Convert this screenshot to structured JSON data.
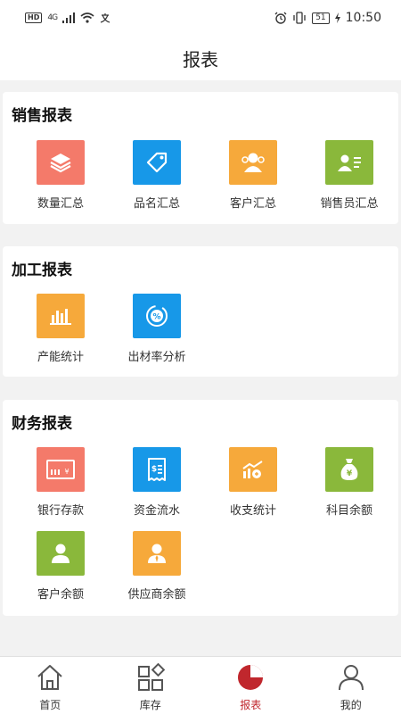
{
  "status_bar": {
    "hd": "HD",
    "network": "4G",
    "time": "10:50",
    "battery": "51"
  },
  "header": {
    "title": "报表"
  },
  "sections": [
    {
      "title": "销售报表",
      "items": [
        {
          "label": "数量汇总",
          "icon": "layers-icon",
          "color": "#f47a6a"
        },
        {
          "label": "品名汇总",
          "icon": "tag-icon",
          "color": "#1798e8"
        },
        {
          "label": "客户汇总",
          "icon": "customers-icon",
          "color": "#f6a93b"
        },
        {
          "label": "销售员汇总",
          "icon": "salesperson-card-icon",
          "color": "#8ab83b"
        }
      ]
    },
    {
      "title": "加工报表",
      "items": [
        {
          "label": "产能统计",
          "icon": "bar-chart-icon",
          "color": "#f6a93b"
        },
        {
          "label": "出材率分析",
          "icon": "percent-icon",
          "color": "#1798e8"
        }
      ]
    },
    {
      "title": "财务报表",
      "items": [
        {
          "label": "银行存款",
          "icon": "bank-card-icon",
          "color": "#f47a6a"
        },
        {
          "label": "资金流水",
          "icon": "receipt-icon",
          "color": "#1798e8"
        },
        {
          "label": "收支统计",
          "icon": "trend-icon",
          "color": "#f6a93b"
        },
        {
          "label": "科目余额",
          "icon": "money-bag-icon",
          "color": "#8ab83b"
        },
        {
          "label": "客户余额",
          "icon": "person-icon",
          "color": "#8ab83b"
        },
        {
          "label": "供应商余额",
          "icon": "supplier-icon",
          "color": "#f6a93b"
        }
      ]
    }
  ],
  "tabbar": {
    "active": 2,
    "tabs": [
      {
        "label": "首页",
        "icon": "home-icon"
      },
      {
        "label": "库存",
        "icon": "grid-icon"
      },
      {
        "label": "报表",
        "icon": "pie-chart-icon"
      },
      {
        "label": "我的",
        "icon": "user-icon"
      }
    ]
  }
}
